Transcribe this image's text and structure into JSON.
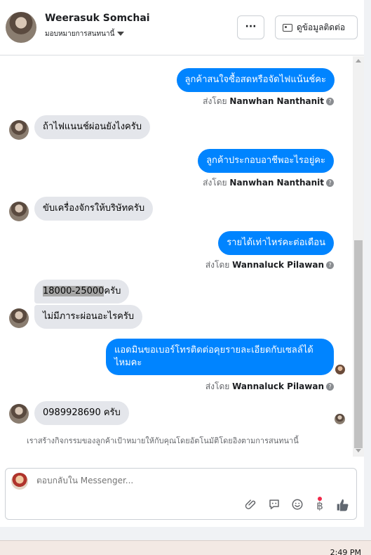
{
  "header": {
    "name": "Weerasuk Somchai",
    "assign_label": "มอบหมายการสนทนานี้",
    "more_label": "···",
    "contact_label": "ดูข้อมูลติดต่อ"
  },
  "messages": [
    {
      "text": "ลูกค้าสนใจซื้อสดหรือจัดไฟแน้นช์คะ",
      "sent_by_prefix": "ส่งโดย",
      "sent_by": "Nanwhan Nanthanit"
    },
    {
      "text": "ถ้าไฟแนนช์ผ่อนยังไงครับ"
    },
    {
      "text": "ลูกค้าประกอบอาชีพอะไรอยู่คะ",
      "sent_by_prefix": "ส่งโดย",
      "sent_by": "Nanwhan Nanthanit"
    },
    {
      "text": "ขับเครื่องจักรให้บริษัทครับ"
    },
    {
      "text": "รายได้เท่าไหร่คะต่อเดือน",
      "sent_by_prefix": "ส่งโดย",
      "sent_by": "Wannaluck Pilawan"
    },
    {
      "text_hl": "18000-25000",
      "text_rest": "ครับ"
    },
    {
      "text": "ไม่มีภาระผ่อนอะไรครับ"
    },
    {
      "text": "แอดมินขอเบอร์โทรติดต่อคุยรายละเอียดกับเซลล์ได้ไหมคะ",
      "sent_by_prefix": "ส่งโดย",
      "sent_by": "Wannaluck Pilawan"
    },
    {
      "text": "0989928690 ครับ"
    }
  ],
  "notice": "เราสร้างกิจกรรมของลูกค้าเป้าหมายให้กับคุณโดยอัตโนมัติโดยอิงตามการสนทนานี้",
  "composer": {
    "placeholder": "ตอบกลับใน Messenger..."
  },
  "taskbar": {
    "clock": "2:49 PM"
  },
  "colors": {
    "outgoing": "#0084ff",
    "incoming": "#e4e6eb",
    "like": "#0084ff"
  }
}
